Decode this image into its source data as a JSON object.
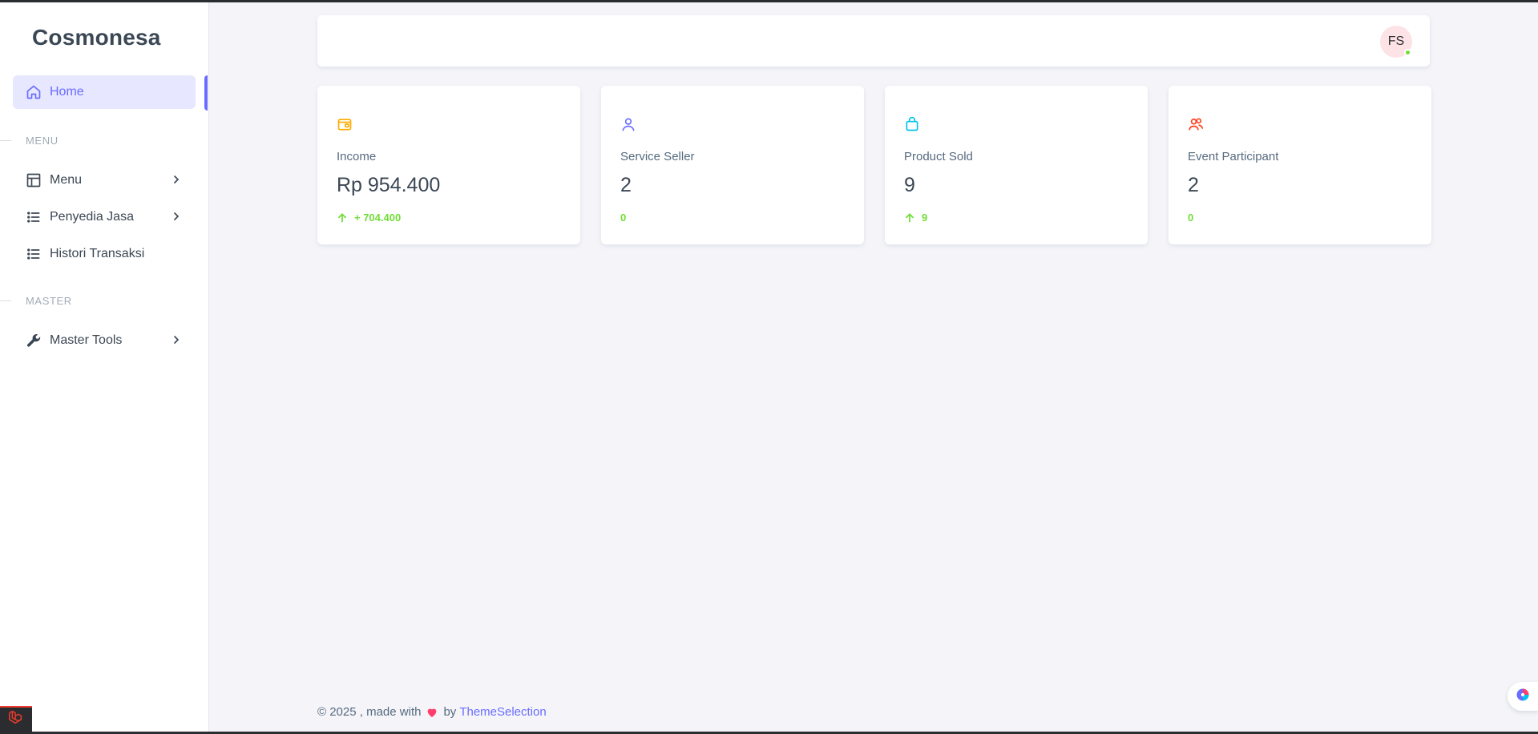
{
  "sidebar": {
    "brand": "Cosmonesa",
    "home": {
      "label": "Home",
      "icon": "home-icon"
    },
    "sections": [
      {
        "title": "MENU"
      },
      {
        "title": "MASTER"
      }
    ],
    "items": [
      {
        "label": "Menu",
        "icon": "layout-icon",
        "has_submenu": true
      },
      {
        "label": "Penyedia Jasa",
        "icon": "list-icon",
        "has_submenu": true
      },
      {
        "label": "Histori Transaksi",
        "icon": "list-icon",
        "has_submenu": false
      },
      {
        "label": "Master Tools",
        "icon": "wrench-icon",
        "has_submenu": true
      }
    ]
  },
  "topbar": {
    "avatar_initials": "FS",
    "status": "online"
  },
  "cards": [
    {
      "label": "Income",
      "value": "Rp 954.400",
      "trend": "+ 704.400",
      "trend_up": true,
      "icon": "wallet-icon",
      "icon_color": "#ffab00"
    },
    {
      "label": "Service Seller",
      "value": "2",
      "trend": "0",
      "trend_up": false,
      "icon": "user-icon",
      "icon_color": "#696cff"
    },
    {
      "label": "Product Sold",
      "value": "9",
      "trend": "9",
      "trend_up": true,
      "icon": "shopping-bag-icon",
      "icon_color": "#03c3ec"
    },
    {
      "label": "Event Participant",
      "value": "2",
      "trend": "0",
      "trend_up": false,
      "icon": "users-icon",
      "icon_color": "#ff3e1d"
    }
  ],
  "footer": {
    "prefix": "© 2025 , made with",
    "by": "by",
    "link": "ThemeSelection"
  },
  "colors": {
    "primary": "#696cff",
    "success": "#71dd37",
    "background": "#f5f5f9"
  }
}
